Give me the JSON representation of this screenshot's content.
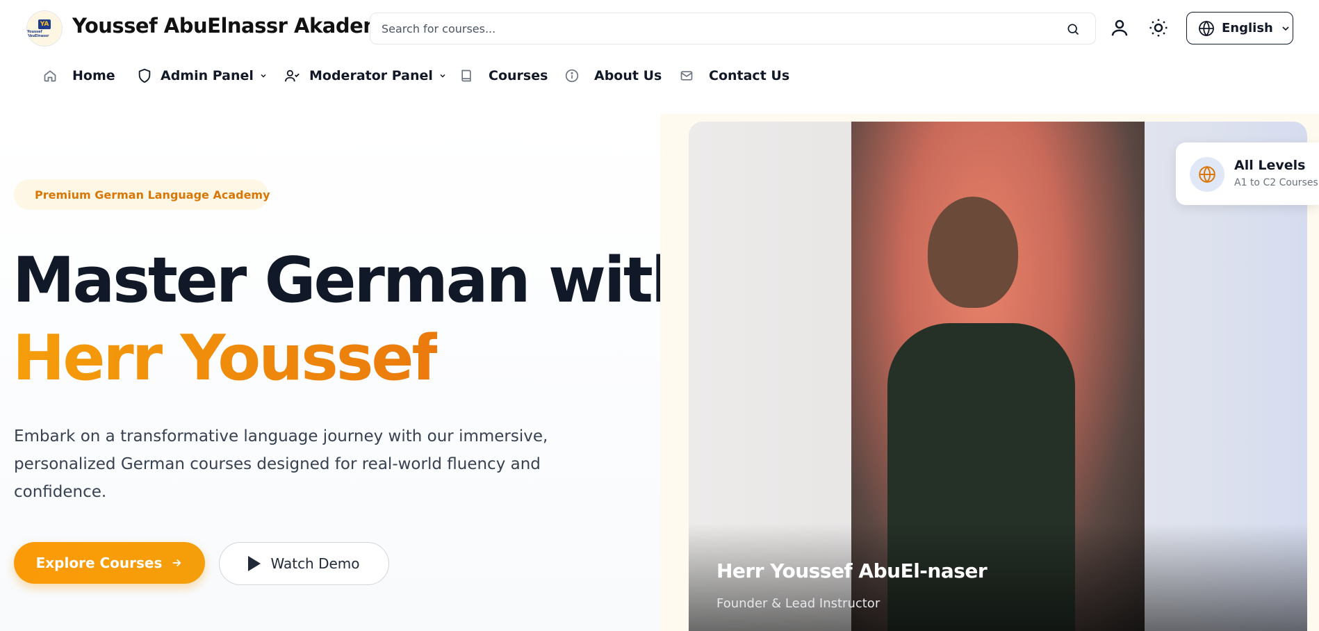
{
  "header": {
    "brand": "Youssef AbuElnassr Akademie",
    "logo_text": "YA",
    "logo_subtext": "Youssef AbuElnassr",
    "search_placeholder": "Search for courses...",
    "language": "English"
  },
  "nav": {
    "items": [
      {
        "label": "Home",
        "icon": "home-icon"
      },
      {
        "label": "Admin Panel",
        "icon": "shield-icon",
        "dropdown": true
      },
      {
        "label": "Moderator Panel",
        "icon": "user-check-icon",
        "dropdown": true
      },
      {
        "label": "Courses",
        "icon": "book-icon"
      },
      {
        "label": "About Us",
        "icon": "info-icon"
      },
      {
        "label": "Contact Us",
        "icon": "mail-icon"
      }
    ]
  },
  "hero": {
    "badge": "Premium German Language Academy",
    "title_line1": "Master German with",
    "title_line2": "Herr Youssef",
    "description": "Embark on a transformative language journey with our immersive, personalized German courses designed for real-world fluency and confidence.",
    "primary_button": "Explore Courses",
    "secondary_button": "Watch Demo"
  },
  "instructor": {
    "name": "Herr Youssef AbuEl-naser",
    "role": "Founder & Lead Instructor"
  },
  "levels_card": {
    "title": "All Levels",
    "subtitle": "A1 to C2 Courses"
  },
  "colors": {
    "accent": "#f59e0b",
    "text_dark": "#111827",
    "text_muted": "#374151"
  }
}
